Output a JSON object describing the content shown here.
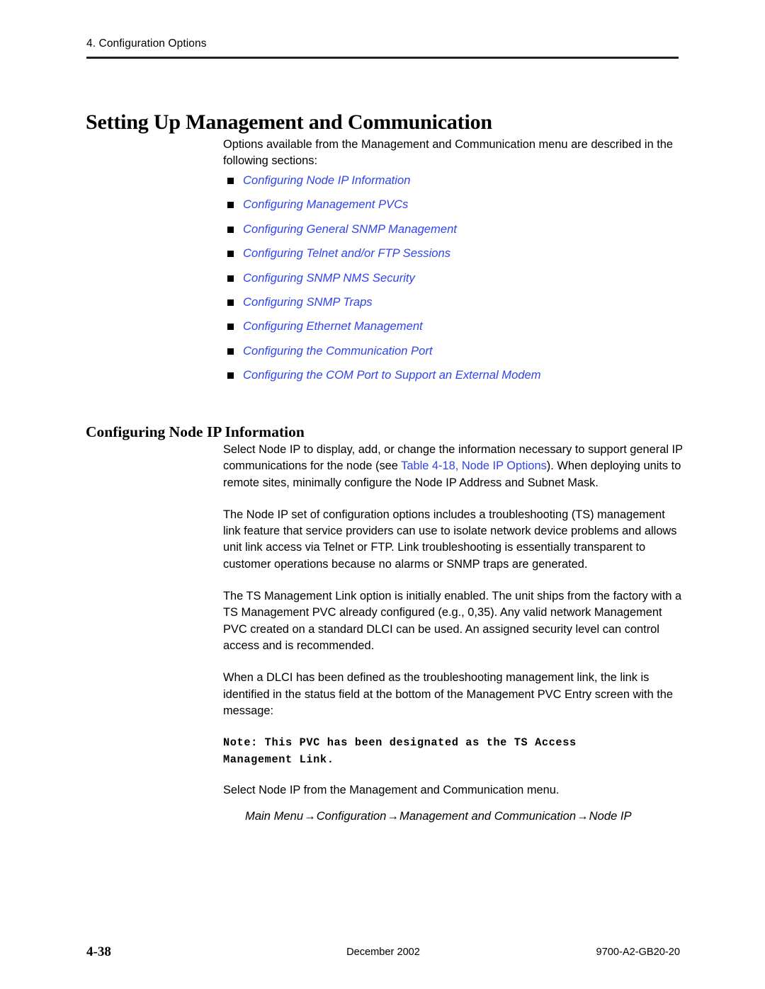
{
  "header": {
    "chapter": "4. Configuration Options"
  },
  "title": "Setting Up Management and Communication",
  "intro": "Options available from the Management and Communication menu are described in the following sections:",
  "link_list": [
    {
      "label": "Configuring Node IP Information"
    },
    {
      "label": "Configuring Management PVCs"
    },
    {
      "label": "Configuring General SNMP Management"
    },
    {
      "label": "Configuring Telnet and/or FTP Sessions"
    },
    {
      "label": "Configuring SNMP NMS Security"
    },
    {
      "label": "Configuring SNMP Traps"
    },
    {
      "label": "Configuring Ethernet Management"
    },
    {
      "label": "Configuring the Communication Port"
    },
    {
      "label": "Configuring the COM Port to Support an External Modem"
    }
  ],
  "section": {
    "heading": "Configuring Node IP Information",
    "para1_before": "Select Node IP to display, add, or change the information necessary to support general IP communications for the node (see ",
    "para1_link": "Table 4-18, Node IP Options",
    "para1_after": "). When deploying units to remote sites, minimally configure the Node IP Address and Subnet Mask.",
    "para2": "The Node IP set of configuration options includes a troubleshooting (TS) management link feature that service providers can use to isolate network device problems and allows unit link access via Telnet or FTP. Link troubleshooting is essentially transparent to customer operations because no alarms or SNMP traps are generated.",
    "para3": "The TS Management Link option is initially enabled. The unit ships from the factory with a TS Management PVC already configured (e.g., 0,35). Any valid network Management PVC created on a standard DLCI can be used. An assigned security level can control access and is recommended.",
    "para4": "When a DLCI has been defined as the troubleshooting management link, the link is identified in the status field at the bottom of the Management PVC Entry screen with the message:",
    "note": "Note: This PVC has been designated as the TS Access\nManagement Link.",
    "para5": "Select Node IP from the Management and Communication menu.",
    "menu_path": [
      "Main Menu",
      "Configuration",
      "Management and Communication",
      "Node IP"
    ],
    "menu_path_arrow": "→"
  },
  "footer": {
    "page_number": "4-38",
    "date": "December 2002",
    "doc_number": "9700-A2-GB20-20"
  },
  "colors": {
    "link_blue": "#2f43ee",
    "rule_dark": "#1b2328",
    "text_black": "#000000"
  }
}
